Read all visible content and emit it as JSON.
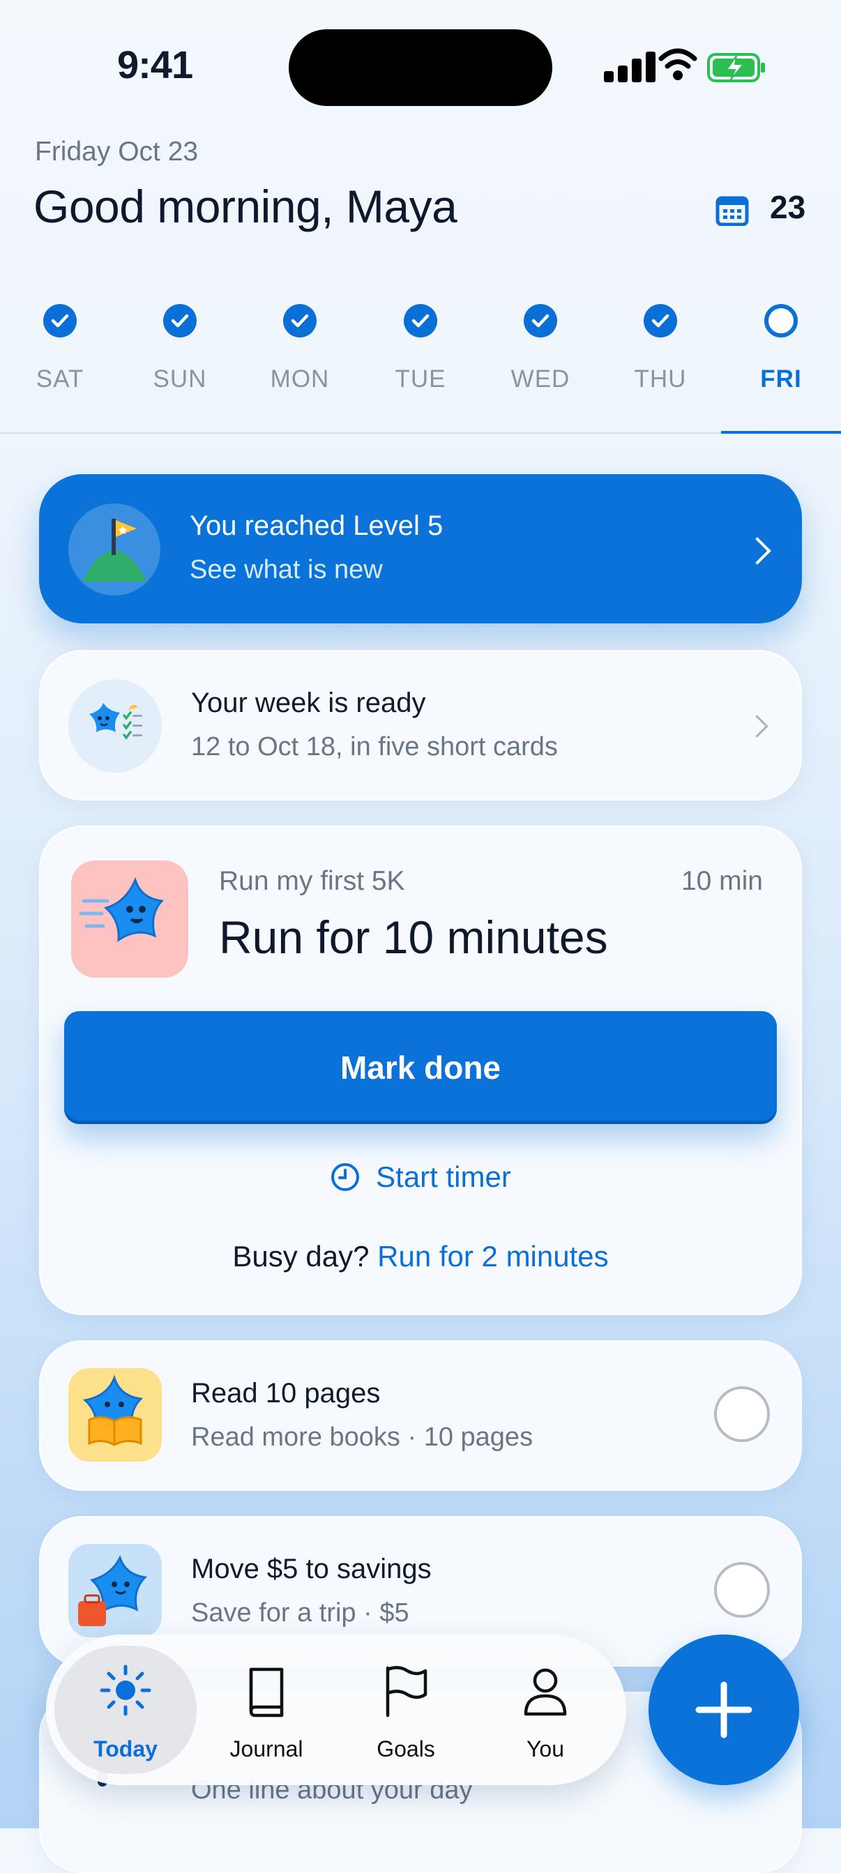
{
  "status": {
    "time": "9:41"
  },
  "header": {
    "date": "Friday Oct 23",
    "greeting": "Good morning, Maya",
    "streak_count": "23",
    "streak_icon": "calendar-icon"
  },
  "week": {
    "days": [
      {
        "label": "SAT",
        "done": true
      },
      {
        "label": "SUN",
        "done": true
      },
      {
        "label": "MON",
        "done": true
      },
      {
        "label": "TUE",
        "done": true
      },
      {
        "label": "WED",
        "done": true
      },
      {
        "label": "THU",
        "done": true
      },
      {
        "label": "FRI",
        "done": false,
        "active": true
      }
    ]
  },
  "level_card": {
    "title": "You reached Level 5",
    "subtitle": "See what is new",
    "icon": "flag-mountain-icon"
  },
  "week_card": {
    "title": "Your week is ready",
    "subtitle": "12 to Oct 18, in five short cards",
    "icon": "star-checklist-icon"
  },
  "task_card": {
    "goal": "Run my first 5K",
    "duration": "10 min",
    "title": "Run for 10 minutes",
    "primary_button": "Mark done",
    "timer_label": "Start timer",
    "busy_prefix": "Busy day?",
    "busy_link": "Run for 2 minutes",
    "icon": "running-star-icon"
  },
  "habits": [
    {
      "title": "Read 10 pages",
      "subtitle": "Read more books · 10 pages",
      "icon": "reading-star-icon",
      "done": false
    },
    {
      "title": "Move $5 to savings",
      "subtitle": "Save for a trip · $5",
      "icon": "suitcase-star-icon",
      "done": false
    }
  ],
  "journal_card": {
    "subtitle": "One line about your day"
  },
  "tabs": [
    {
      "label": "Today",
      "icon": "sun-icon",
      "active": true
    },
    {
      "label": "Journal",
      "icon": "book-icon",
      "active": false
    },
    {
      "label": "Goals",
      "icon": "flag-icon",
      "active": false
    },
    {
      "label": "You",
      "icon": "person-icon",
      "active": false
    }
  ],
  "fab": {
    "icon": "plus-icon"
  },
  "colors": {
    "accent": "#0a72d8",
    "text": "#0e1a2c",
    "muted": "#6a7685",
    "task_icon_bg": "#fdc3c0",
    "read_icon_bg": "#fde08a",
    "save_icon_bg": "#c7e1f8"
  }
}
